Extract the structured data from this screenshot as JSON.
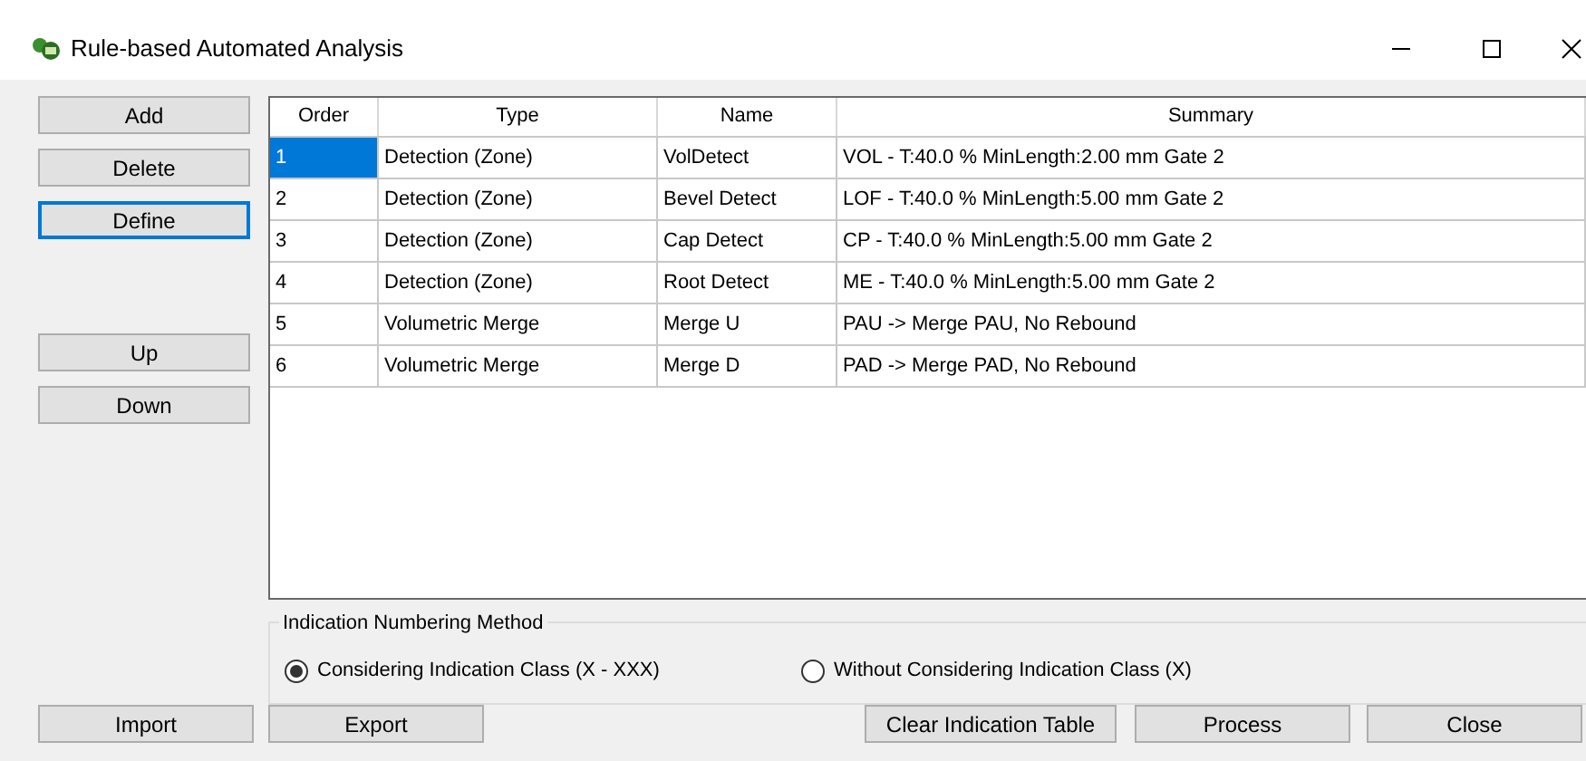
{
  "window": {
    "title": "Rule-based Automated Analysis"
  },
  "side_buttons": {
    "edit": [
      {
        "label": "Add",
        "focused": false
      },
      {
        "label": "Delete",
        "focused": false
      },
      {
        "label": "Define",
        "focused": true
      }
    ],
    "move": [
      {
        "label": "Up",
        "focused": false
      },
      {
        "label": "Down",
        "focused": false
      }
    ]
  },
  "table": {
    "columns": [
      "Order",
      "Type",
      "Name",
      "Summary"
    ],
    "rows": [
      {
        "cells": [
          "1",
          "Detection (Zone)",
          "VolDetect",
          "VOL - T:40.0 % MinLength:2.00 mm Gate 2"
        ],
        "selected": true
      },
      {
        "cells": [
          "2",
          "Detection (Zone)",
          "Bevel Detect",
          "LOF - T:40.0 % MinLength:5.00 mm Gate 2"
        ],
        "selected": false
      },
      {
        "cells": [
          "3",
          "Detection (Zone)",
          "Cap Detect",
          "CP - T:40.0 % MinLength:5.00 mm Gate 2"
        ],
        "selected": false
      },
      {
        "cells": [
          "4",
          "Detection (Zone)",
          "Root Detect",
          "ME - T:40.0 % MinLength:5.00 mm Gate 2"
        ],
        "selected": false
      },
      {
        "cells": [
          "5",
          "Volumetric Merge",
          "Merge U",
          "PAU -> Merge PAU, No Rebound"
        ],
        "selected": false
      },
      {
        "cells": [
          "6",
          "Volumetric Merge",
          "Merge D",
          "PAD -> Merge PAD, No Rebound"
        ],
        "selected": false
      }
    ]
  },
  "numbering": {
    "title": "Indication Numbering Method",
    "options": [
      {
        "label": "Considering Indication Class (X - XXX)",
        "selected": true
      },
      {
        "label": "Without Considering Indication Class (X)",
        "selected": false
      }
    ]
  },
  "bottom_buttons": [
    "Import",
    "Export",
    "Clear Indication Table",
    "Process",
    "Close"
  ]
}
